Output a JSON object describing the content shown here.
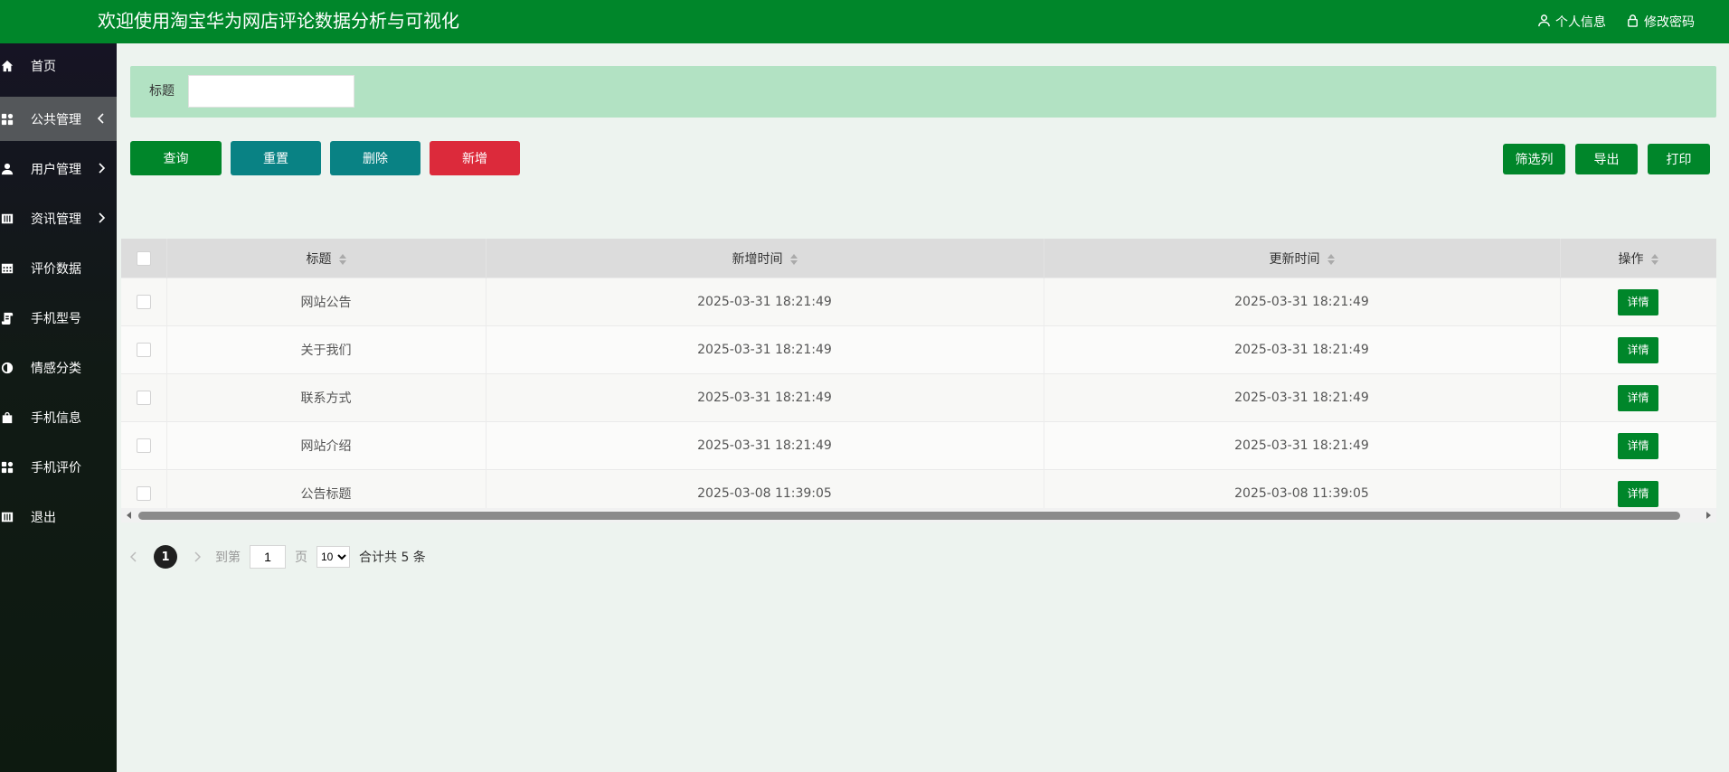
{
  "header": {
    "title": "欢迎使用淘宝华为网店评论数据分析与可视化",
    "profile_label": "个人信息",
    "password_label": "修改密码"
  },
  "sidebar": {
    "items": [
      {
        "label": "首页",
        "icon": "home-icon",
        "has_arrow": false,
        "active": false
      },
      {
        "label": "公共管理",
        "icon": "grid-icon",
        "has_arrow": true,
        "active": true
      },
      {
        "label": "用户管理",
        "icon": "user-icon",
        "has_arrow": true,
        "active": false
      },
      {
        "label": "资讯管理",
        "icon": "columns-icon",
        "has_arrow": true,
        "active": false
      },
      {
        "label": "评价数据",
        "icon": "calendar-icon",
        "has_arrow": false,
        "active": false
      },
      {
        "label": "手机型号",
        "icon": "scroll-icon",
        "has_arrow": false,
        "active": false
      },
      {
        "label": "情感分类",
        "icon": "half-circle-icon",
        "has_arrow": false,
        "active": false
      },
      {
        "label": "手机信息",
        "icon": "bag-icon",
        "has_arrow": false,
        "active": false
      },
      {
        "label": "手机评价",
        "icon": "grid-icon",
        "has_arrow": false,
        "active": false
      },
      {
        "label": "退出",
        "icon": "columns-icon",
        "has_arrow": false,
        "active": false
      }
    ]
  },
  "filter": {
    "label": "标题",
    "value": "",
    "placeholder": ""
  },
  "actions": {
    "search": "查询",
    "reset": "重置",
    "delete": "删除",
    "add": "新增",
    "columns": "筛选列",
    "export": "导出",
    "print": "打印"
  },
  "table": {
    "columns": [
      "标题",
      "新增时间",
      "更新时间",
      "操作"
    ],
    "rows": [
      {
        "title": "网站公告",
        "created": "2025-03-31 18:21:49",
        "updated": "2025-03-31 18:21:49",
        "action": "详情"
      },
      {
        "title": "关于我们",
        "created": "2025-03-31 18:21:49",
        "updated": "2025-03-31 18:21:49",
        "action": "详情"
      },
      {
        "title": "联系方式",
        "created": "2025-03-31 18:21:49",
        "updated": "2025-03-31 18:21:49",
        "action": "详情"
      },
      {
        "title": "网站介绍",
        "created": "2025-03-31 18:21:49",
        "updated": "2025-03-31 18:21:49",
        "action": "详情"
      },
      {
        "title": "公告标题",
        "created": "2025-03-08 11:39:05",
        "updated": "2025-03-08 11:39:05",
        "action": "详情"
      }
    ]
  },
  "pagination": {
    "current_page": "1",
    "goto_label": "到第",
    "goto_value": "1",
    "page_unit": "页",
    "page_size": "10",
    "total_text": "合计共 5 条"
  },
  "colors": {
    "brand_green": "#00862a",
    "teal": "#098284",
    "danger": "#dc2a3b",
    "filter_bg": "#b2e2c3"
  }
}
